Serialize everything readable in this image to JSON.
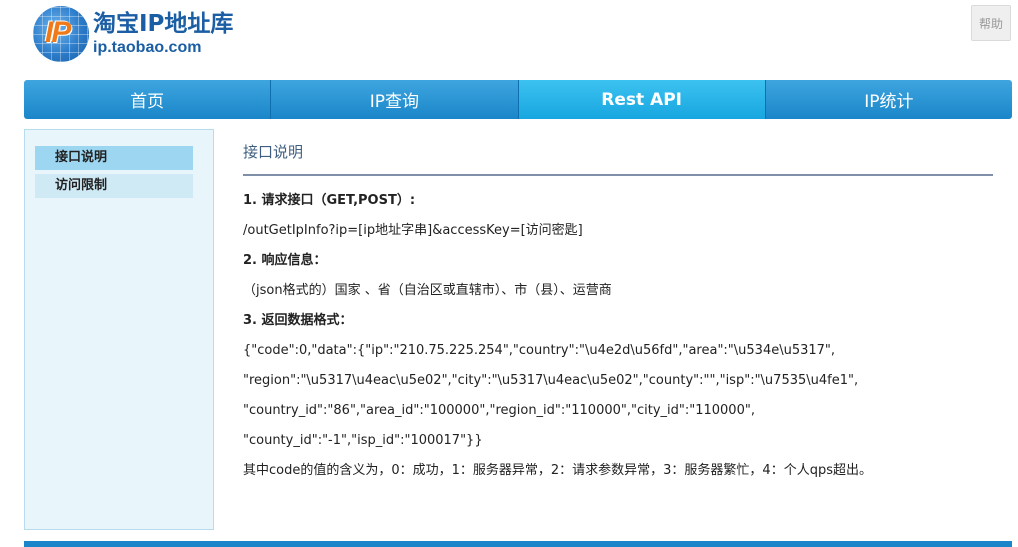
{
  "header": {
    "logo_mark_text": "IP",
    "title": "淘宝IP地址库",
    "subtitle": "ip.taobao.com",
    "help_label": "帮助"
  },
  "nav": {
    "tabs": [
      {
        "label": "首页"
      },
      {
        "label": "IP查询"
      },
      {
        "label": "Rest API"
      },
      {
        "label": "IP统计"
      }
    ],
    "active_index": 2
  },
  "sidebar": {
    "items": [
      {
        "label": "接口说明"
      },
      {
        "label": "访问限制"
      }
    ]
  },
  "main": {
    "title": "接口说明",
    "lines": [
      "1. 请求接口（GET,POST）:",
      "/outGetIpInfo?ip=[ip地址字串]&accessKey=[访问密匙]",
      "2. 响应信息：",
      "（json格式的）国家 、省（自治区或直辖市）、市（县）、运营商",
      "3. 返回数据格式：",
      "{\"code\":0,\"data\":{\"ip\":\"210.75.225.254\",\"country\":\"\\u4e2d\\u56fd\",\"area\":\"\\u534e\\u5317\",",
      "\"region\":\"\\u5317\\u4eac\\u5e02\",\"city\":\"\\u5317\\u4eac\\u5e02\",\"county\":\"\",\"isp\":\"\\u7535\\u4fe1\",",
      "\"country_id\":\"86\",\"area_id\":\"100000\",\"region_id\":\"110000\",\"city_id\":\"110000\",",
      "\"county_id\":\"-1\",\"isp_id\":\"100017\"}}",
      "其中code的值的含义为，0：成功，1：服务器异常，2：请求参数异常，3：服务器繁忙，4：个人qps超出。"
    ]
  },
  "colors": {
    "brand": "#1b5ea4",
    "nav": "#1a86c9",
    "nav_active": "#17a6e0",
    "sidebar_bg": "#e8f5fb"
  }
}
